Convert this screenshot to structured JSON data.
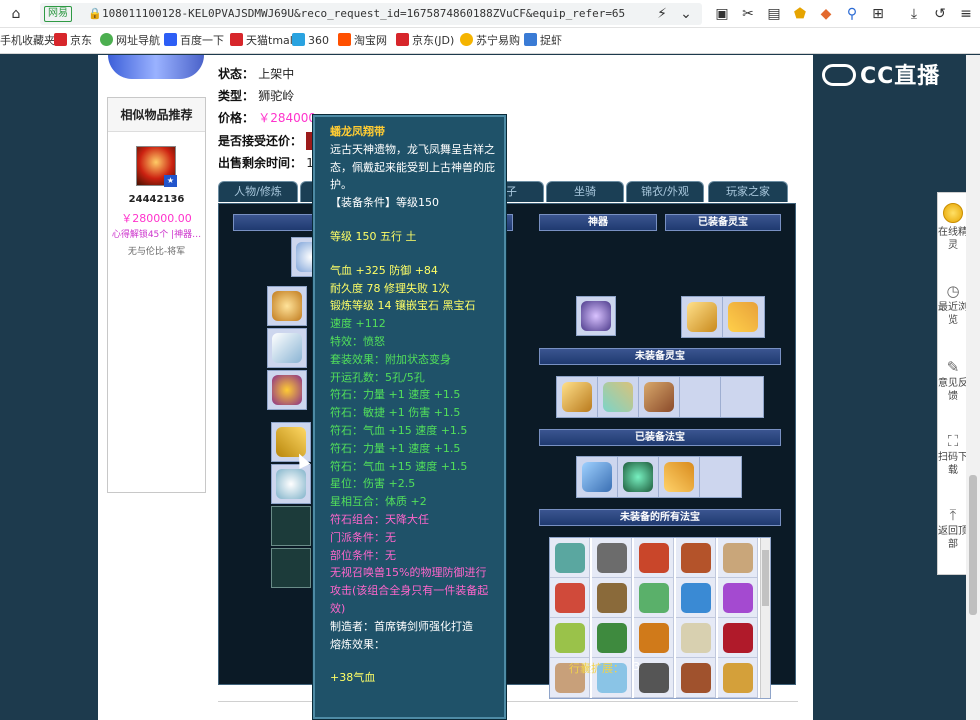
{
  "browser": {
    "url_badge": "网易",
    "url": "108011100128-KEL0PVAJSDMWJ69U&reco_request_id=1675874860188ZVuCF&equip_refer=65",
    "bookmarks": [
      "手机收藏夹",
      "京东",
      "网址导航",
      "百度一下",
      "天猫tmall",
      "360",
      "淘宝网",
      "京东(JD)",
      "苏宁易购",
      "捉虾"
    ]
  },
  "logo": "CC直播",
  "item": {
    "status_label": "状态：",
    "status_value": "上架中",
    "type_label": "类型：",
    "type_value": "狮驼岭",
    "price_label": "价格：",
    "price_value": "￥284000.",
    "bargain_label": "是否接受还价：",
    "remaining_label": "出售剩余时间：",
    "remaining_value": "12"
  },
  "similar": {
    "title": "相似物品推荐",
    "id": "24442136",
    "price": "￥280000.00",
    "desc": "心得解锁45个 |神器…",
    "seller": "无与伦比-将军"
  },
  "tabs": [
    "人物/修炼",
    "",
    "",
    "/孩子",
    "坐骑",
    "锦衣/外观",
    "玩家之家"
  ],
  "panel": {
    "shenqi": "神器",
    "equipped_lingbao": "已装备灵宝",
    "unequipped_lingbao": "未装备灵宝",
    "equipped_fabao": "已装备法宝",
    "unequipped_fabao": "未装备的所有法宝",
    "expand_label": "行囊扩展：",
    "expand_value": "3"
  },
  "tooltip": [
    {
      "text": "蟠龙凤翔带",
      "color": "title"
    },
    {
      "text": "远古天神遗物，龙飞凤舞呈吉祥之态，佩戴起来能受到上古神兽的庇护。",
      "color": "white"
    },
    {
      "text": "【装备条件】等级150",
      "color": "white"
    },
    {
      "text": "",
      "color": "gap"
    },
    {
      "text": "等级 150 五行 土",
      "color": "yellow"
    },
    {
      "text": "",
      "color": "gap"
    },
    {
      "text": "气血 +325 防御 +84",
      "color": "yellow"
    },
    {
      "text": "耐久度 78 修理失败 1次",
      "color": "yellow"
    },
    {
      "text": "锻炼等级 14 镶嵌宝石 黑宝石",
      "color": "yellow"
    },
    {
      "text": "速度 +112",
      "color": "green"
    },
    {
      "text": "特效：愤怒",
      "color": "green"
    },
    {
      "text": "套装效果：附加状态变身",
      "color": "green"
    },
    {
      "text": "开运孔数：5孔/5孔",
      "color": "green"
    },
    {
      "text": "符石：力量 +1 速度 +1.5",
      "color": "green"
    },
    {
      "text": "符石：敏捷 +1 伤害 +1.5",
      "color": "green"
    },
    {
      "text": "符石：气血 +15 速度 +1.5",
      "color": "green"
    },
    {
      "text": "符石：力量 +1 速度 +1.5",
      "color": "green"
    },
    {
      "text": "符石：气血 +15 速度 +1.5",
      "color": "green"
    },
    {
      "text": "星位：伤害 +2.5",
      "color": "green"
    },
    {
      "text": "星相互合：体质 +2",
      "color": "green"
    },
    {
      "text": "符石组合：天降大任",
      "color": "pink"
    },
    {
      "text": "门派条件：无",
      "color": "pink"
    },
    {
      "text": "部位条件：无",
      "color": "pink"
    },
    {
      "text": "无视召唤兽15%的物理防御进行攻击(该组合全身只有一件装备起效)",
      "color": "pink"
    },
    {
      "text": "制造者：首席铸剑师强化打造",
      "color": "white"
    },
    {
      "text": "熔炼效果：",
      "color": "white"
    },
    {
      "text": "",
      "color": "gap"
    },
    {
      "text": "+38气血",
      "color": "yellow"
    }
  ],
  "sidebar": [
    {
      "label": "在线精灵",
      "icon": "avatar-icon"
    },
    {
      "label": "最近浏览",
      "icon": "clock-icon"
    },
    {
      "label": "意见反馈",
      "icon": "edit-icon"
    },
    {
      "label": "扫码下载",
      "icon": "scan-icon"
    },
    {
      "label": "返回顶部",
      "icon": "top-arrow-icon"
    }
  ]
}
